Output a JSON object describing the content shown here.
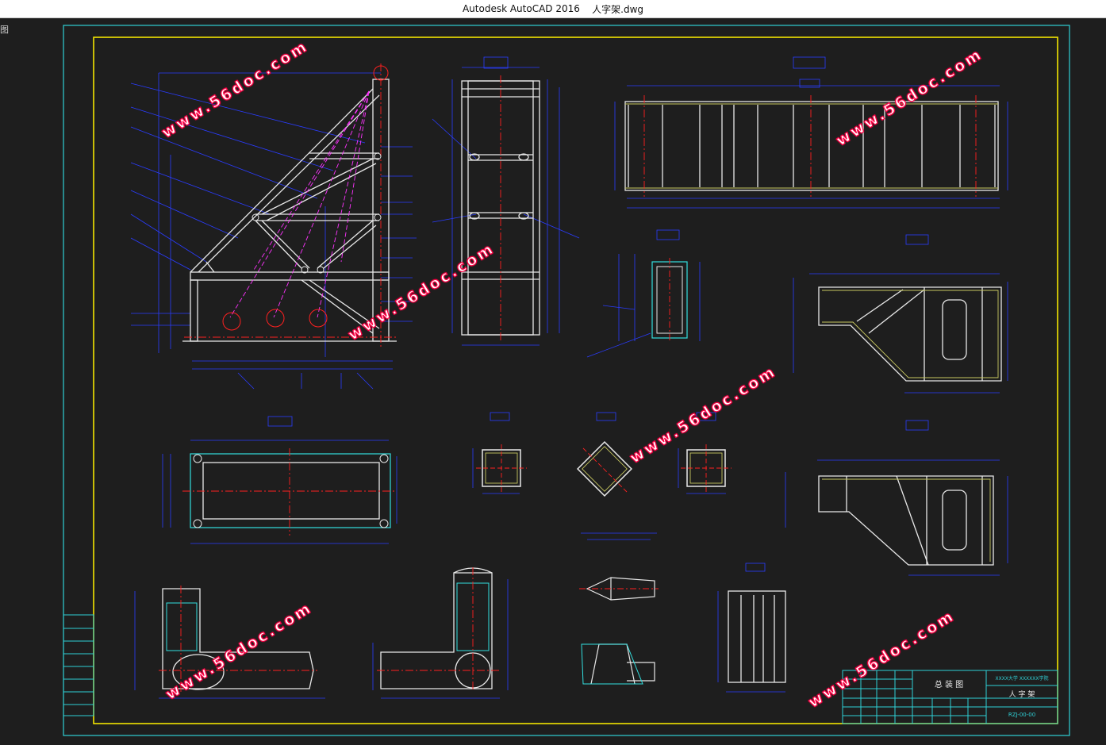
{
  "window": {
    "app_title": "Autodesk AutoCAD 2016",
    "file_name": "人字架.dwg",
    "side_label": "图"
  },
  "watermark": {
    "text": "www.56doc.com",
    "color": "#ff0044"
  },
  "colors": {
    "background": "#1e1e1e",
    "outer_frame": "#2fd0d6",
    "inner_frame": "#f2e500",
    "geometry": "#e8e8e8",
    "dimensions": "#2a3cff",
    "centerlines": "#ff2020",
    "hidden": "#ff33ff",
    "hatch": "#c8c860",
    "aux": "#33e0e0"
  },
  "title_block": {
    "drawing_title": "总 装 图",
    "part_name": "人 字 架",
    "school": "XXXX大学 XXXXXX学院",
    "drawing_no": "RZJ-00-00"
  }
}
